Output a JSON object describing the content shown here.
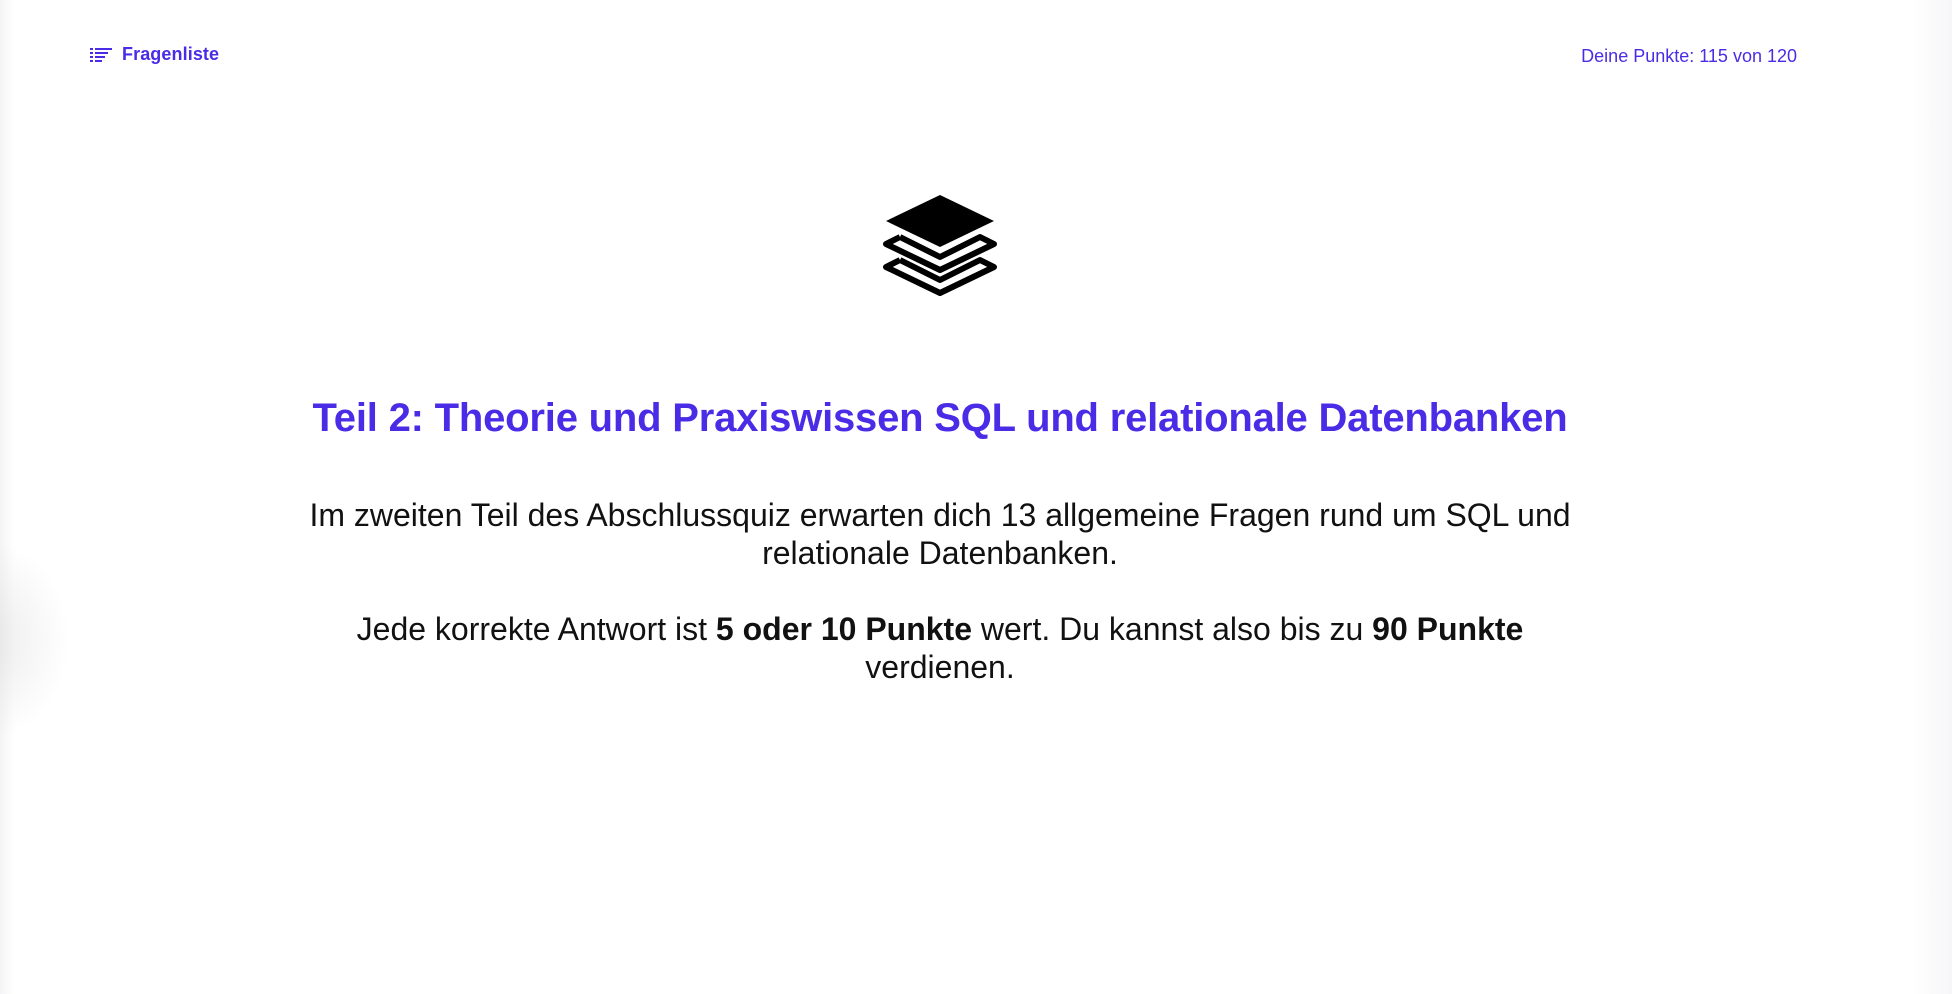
{
  "header": {
    "question_list_label": "Fragenliste",
    "question_list_icon": "list-icon",
    "points_text": "Deine Punkte: 115 von 120"
  },
  "main": {
    "hero_icon": "layers-icon",
    "title": "Teil 2: Theorie und Praxiswissen SQL und relationale Datenbanken",
    "paragraph1": "Im zweiten Teil des Abschlussquiz erwarten dich 13 allgemeine Fragen rund um SQL und relationale Datenbanken.",
    "paragraph2": {
      "part1": "Jede korrekte Antwort ist ",
      "bold1": "5 oder 10 Punkte",
      "part2": " wert. Du kannst also bis zu ",
      "bold2": "90 Punkte",
      "part3": " verdienen."
    }
  },
  "colors": {
    "accent": "#4a2ce6",
    "text": "#111111",
    "background": "#ffffff"
  }
}
